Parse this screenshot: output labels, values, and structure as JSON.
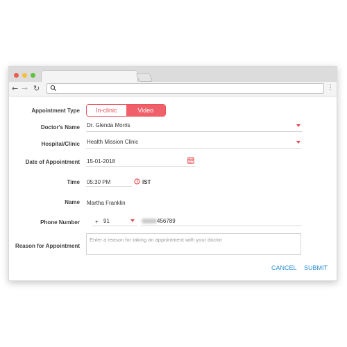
{
  "form": {
    "appointment_type": {
      "label": "Appointment Type",
      "options": [
        "In-clinic",
        "Video"
      ],
      "selected": "Video"
    },
    "doctor": {
      "label": "Doctor's Name",
      "value": "Dr. Glenda Morris"
    },
    "hospital": {
      "label": "Hospital/Clinic",
      "value": "Health Mission Clinic"
    },
    "date": {
      "label": "Date of Appointment",
      "value": "15-01-2018"
    },
    "time": {
      "label": "Time",
      "value": "05:30 PM",
      "timezone": "IST"
    },
    "name": {
      "label": "Name",
      "value": "Martha Franklin"
    },
    "phone": {
      "label": "Phone Number",
      "country_prefix": "+",
      "country_code": "91",
      "number_visible": "456789"
    },
    "reason": {
      "label": "Reason for Appointment",
      "placeholder": "Enter a reason for taking an appointment with your doctor"
    }
  },
  "actions": {
    "cancel_label": "CANCEL",
    "submit_label": "SUBMIT"
  },
  "colors": {
    "accent": "#f0606a",
    "link": "#2b8fd6"
  }
}
